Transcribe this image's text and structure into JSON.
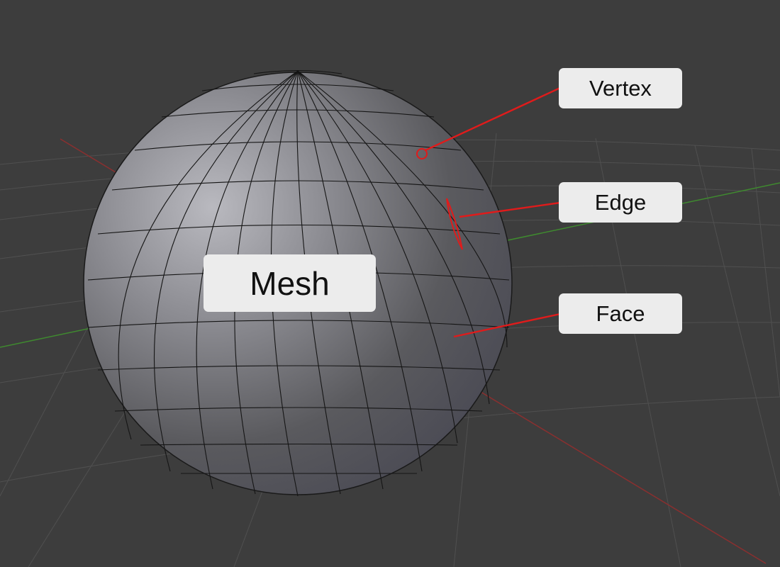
{
  "labels": {
    "vertex": "Vertex",
    "edge": "Edge",
    "face": "Face",
    "mesh": "Mesh"
  },
  "colors": {
    "background": "#3d3d3d",
    "grid": "#4f4f4f",
    "x_axis": "#8a2f2f",
    "y_axis": "#3f8a2f",
    "callout_line": "#e01b1b",
    "label_bg": "#ececec",
    "mesh_wire": "#151515"
  }
}
